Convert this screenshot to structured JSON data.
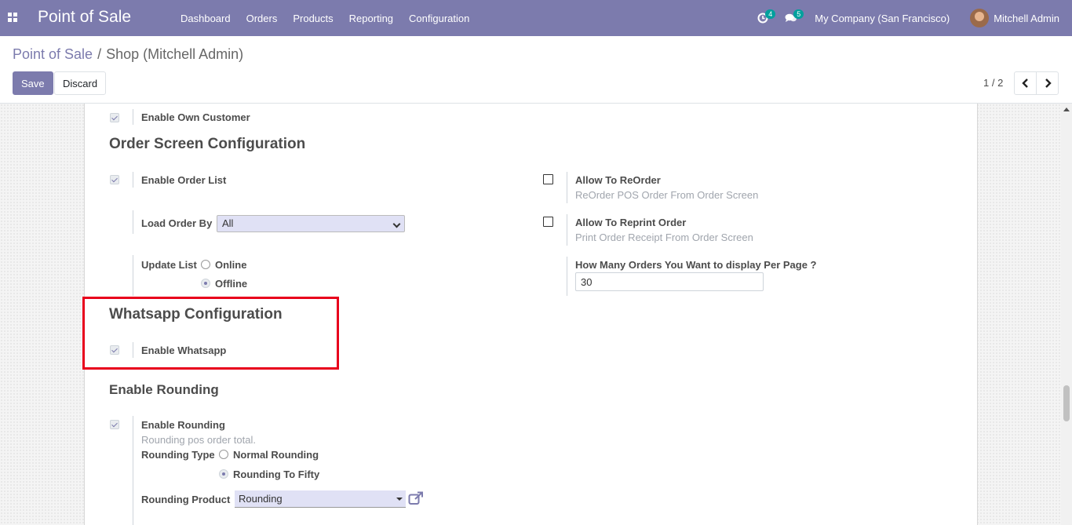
{
  "navbar": {
    "brand": "Point of Sale",
    "menu": [
      "Dashboard",
      "Orders",
      "Products",
      "Reporting",
      "Configuration"
    ],
    "activity_count": "4",
    "message_count": "5",
    "company": "My Company (San Francisco)",
    "user": "Mitchell Admin"
  },
  "breadcrumb": {
    "parent": "Point of Sale",
    "separator": "/",
    "current": "Shop (Mitchell Admin)"
  },
  "buttons": {
    "save": "Save",
    "discard": "Discard"
  },
  "pager": {
    "value": "1 / 2"
  },
  "form": {
    "own_customer": {
      "label": "Enable Own Customer",
      "checked": true
    },
    "order_screen": {
      "title": "Order Screen Configuration",
      "enable_order_list": {
        "label": "Enable Order List",
        "checked": true
      },
      "load_order_by": {
        "label": "Load Order By",
        "value": "All"
      },
      "update_list": {
        "label": "Update List",
        "options": [
          "Online",
          "Offline"
        ],
        "selected": "Offline"
      },
      "allow_reorder": {
        "label": "Allow To ReOrder",
        "help": "ReOrder POS Order From Order Screen",
        "checked": false
      },
      "allow_reprint": {
        "label": "Allow To Reprint Order",
        "help": "Print Order Receipt From Order Screen",
        "checked": false
      },
      "orders_per_page": {
        "label": "How Many Orders You Want to display Per Page ?",
        "value": "30"
      }
    },
    "whatsapp": {
      "title": "Whatsapp Configuration",
      "enable_whatsapp": {
        "label": "Enable Whatsapp",
        "checked": true
      }
    },
    "rounding": {
      "title": "Enable Rounding",
      "enable_rounding": {
        "label": "Enable Rounding",
        "help": "Rounding pos order total.",
        "checked": true
      },
      "rounding_type": {
        "label": "Rounding Type",
        "options": [
          "Normal Rounding",
          "Rounding To Fifty"
        ],
        "selected": "Rounding To Fifty"
      },
      "rounding_product": {
        "label": "Rounding Product",
        "value": "Rounding"
      }
    }
  },
  "colors": {
    "brand": "#7c7bad",
    "highlight": "#e8001c"
  }
}
